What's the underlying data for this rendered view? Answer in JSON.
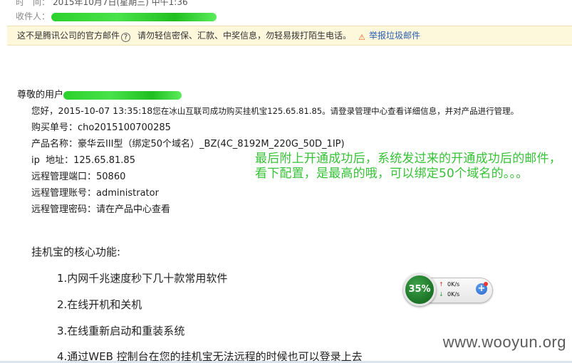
{
  "header": {
    "time_label": "时　间：",
    "time_value": "2015年10月7日(星期三) 中午1:36",
    "to_label": "收件人："
  },
  "warning_bar": {
    "text": "这不是腾讯公司的官方邮件",
    "help_icon": "question-circle-icon",
    "advice": "请勿轻信密保、汇款、中奖信息，勿轻易拨打陌生电话。",
    "report_icon": "report-icon",
    "report_link": "举报垃圾邮件"
  },
  "mail": {
    "greeting": "尊敬的用户",
    "line1_prefix": "您好，2015-10-07 13:35:18",
    "line1_rest": "您在冰山互联司成功购买挂机宝125.65.81.85。请登录管理中心查看详细信息，并对产品进行管理。",
    "order_label": "购买单号：",
    "order_value": "cho2015100700285",
    "product_label": "产品名称：",
    "product_value": "豪华云III型（绑定50个域名）_BZ(4C_8192M_220G_50D_1IP)",
    "ip_label": "ip  地址：",
    "ip_value": "125.65.81.85",
    "port_label": "远程管理端口：",
    "port_value": "50860",
    "account_label": "远程管理账号：",
    "account_value": "administrator",
    "password_label": "远程管理密码：",
    "password_value": "请在产品中心查看",
    "core_title": "挂机宝的核心功能:",
    "features": [
      "1.内网千兆速度秒下几十款常用软件",
      "2.在线开机和关机",
      "3.在线重新启动和重装系统",
      "4.通过WEB 控制台在您的挂机宝无法远程的时候也可以登录上去"
    ]
  },
  "annotation": {
    "text": "最后附上开通成功后，系统发过来的开通成功后的邮件，看下配置，是最高的哦，可以绑定50个域名的。。。"
  },
  "speed_widget": {
    "percent": "35%",
    "up_speed": "0K/s",
    "down_speed": "0K/s",
    "plus_icon": "plus-icon"
  },
  "watermark": "www.wooyun.org",
  "colors": {
    "annotation_green": "#36c236",
    "warning_bg": "#fdf7dc",
    "link_blue": "#2a5db0",
    "widget_green": "#1f7a2a",
    "redaction_green": "#2bd12b"
  }
}
